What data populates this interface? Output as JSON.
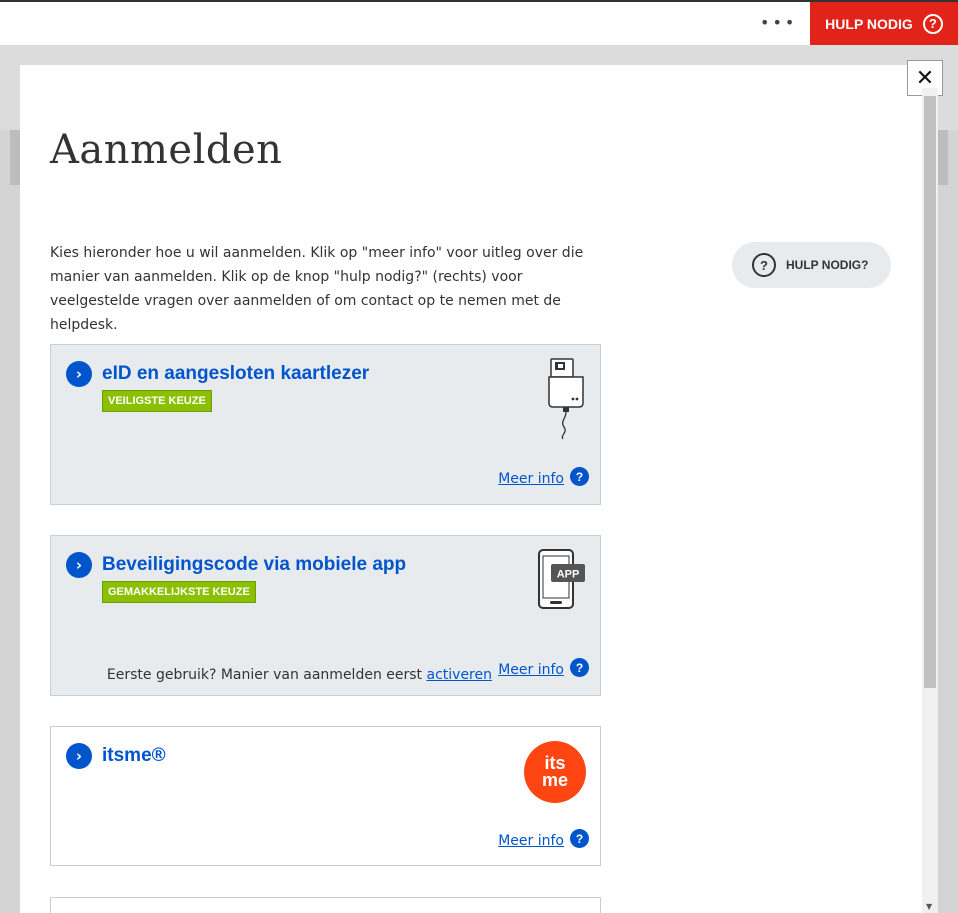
{
  "topbar": {
    "more_label": "•••",
    "help_label": "HULP NODIG",
    "help_icon_glyph": "?"
  },
  "modal": {
    "close_glyph": "✕",
    "title": "Aanmelden",
    "intro": "Kies hieronder hoe u wil aanmelden. Klik op \"meer info\" voor uitleg over die manier van aanmelden. Klik op de knop \"hulp nodig?\" (rechts) voor veelgestelde vragen over aanmelden of om contact op te nemen met de helpdesk.",
    "help_button_label": "HULP NODIG?",
    "help_button_glyph": "?"
  },
  "options": [
    {
      "title": "eID en aangesloten kaartlezer",
      "badge": "VEILIGSTE KEUZE",
      "meer_info": "Meer info",
      "icon": "card-reader-icon"
    },
    {
      "title": "Beveiligingscode via mobiele app",
      "badge": "GEMAKKELIJKSTE KEUZE",
      "first_use_text": "Eerste gebruik? Manier van aanmelden eerst",
      "activate_link": "activeren",
      "meer_info": "Meer info",
      "icon": "mobile-app-icon",
      "app_label": "APP"
    },
    {
      "title": "itsme®",
      "meer_info": "Meer info",
      "icon": "itsme-logo",
      "logo_top": "its",
      "logo_bottom": "me"
    }
  ],
  "colors": {
    "primary": "#0055cc",
    "danger": "#e2231a",
    "badge": "#8bc000",
    "itsme": "#ff4612"
  }
}
